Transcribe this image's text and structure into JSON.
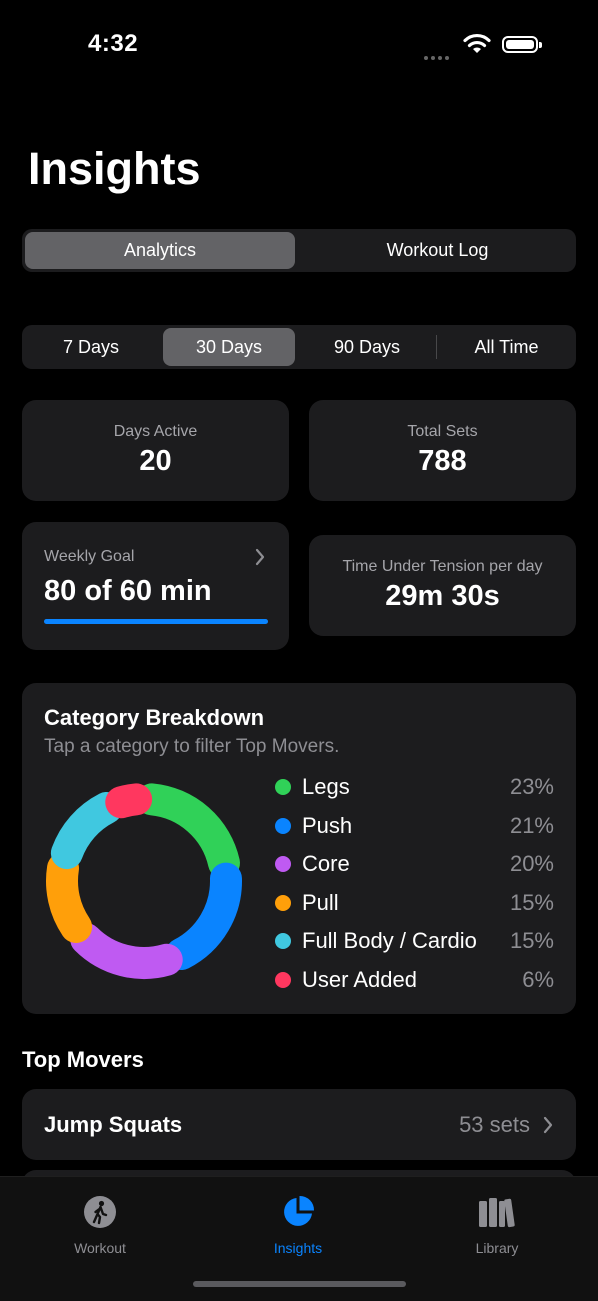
{
  "status_bar": {
    "time": "4:32"
  },
  "page": {
    "title": "Insights"
  },
  "main_tabs": {
    "items": [
      "Analytics",
      "Workout Log"
    ],
    "selected": "Analytics"
  },
  "range": {
    "items": [
      "7 Days",
      "30 Days",
      "90 Days",
      "All Time"
    ],
    "selected": "30 Days"
  },
  "stats": {
    "days_active": {
      "label": "Days Active",
      "value": "20"
    },
    "total_sets": {
      "label": "Total Sets",
      "value": "788"
    },
    "weekly_goal": {
      "label": "Weekly Goal",
      "value": "80 of 60 min",
      "progress": 1.0
    },
    "tut": {
      "label": "Time Under Tension per day",
      "value": "29m 30s"
    }
  },
  "category": {
    "title": "Category Breakdown",
    "subtitle": "Tap a category to filter Top Movers.",
    "items": [
      {
        "name": "Legs",
        "pct": "23%",
        "value": 23,
        "color": "#30d158"
      },
      {
        "name": "Push",
        "pct": "21%",
        "value": 21,
        "color": "#0a84ff"
      },
      {
        "name": "Core",
        "pct": "20%",
        "value": 20,
        "color": "#bf5af2"
      },
      {
        "name": "Pull",
        "pct": "15%",
        "value": 15,
        "color": "#ff9f0a"
      },
      {
        "name": "Full Body / Cardio",
        "pct": "15%",
        "value": 15,
        "color": "#40c8e0"
      },
      {
        "name": "User Added",
        "pct": "6%",
        "value": 6,
        "color": "#ff375f"
      }
    ]
  },
  "top_movers": {
    "title": "Top Movers",
    "items": [
      {
        "name": "Jump Squats",
        "sets": "53 sets"
      }
    ]
  },
  "tabbar": {
    "items": [
      {
        "label": "Workout",
        "icon": "walk-icon"
      },
      {
        "label": "Insights",
        "icon": "pie-chart-icon"
      },
      {
        "label": "Library",
        "icon": "books-icon"
      }
    ],
    "selected": "Insights"
  },
  "colors": {
    "accent": "#0a84ff",
    "card": "#1c1c1e",
    "segment_selected": "#636366"
  }
}
